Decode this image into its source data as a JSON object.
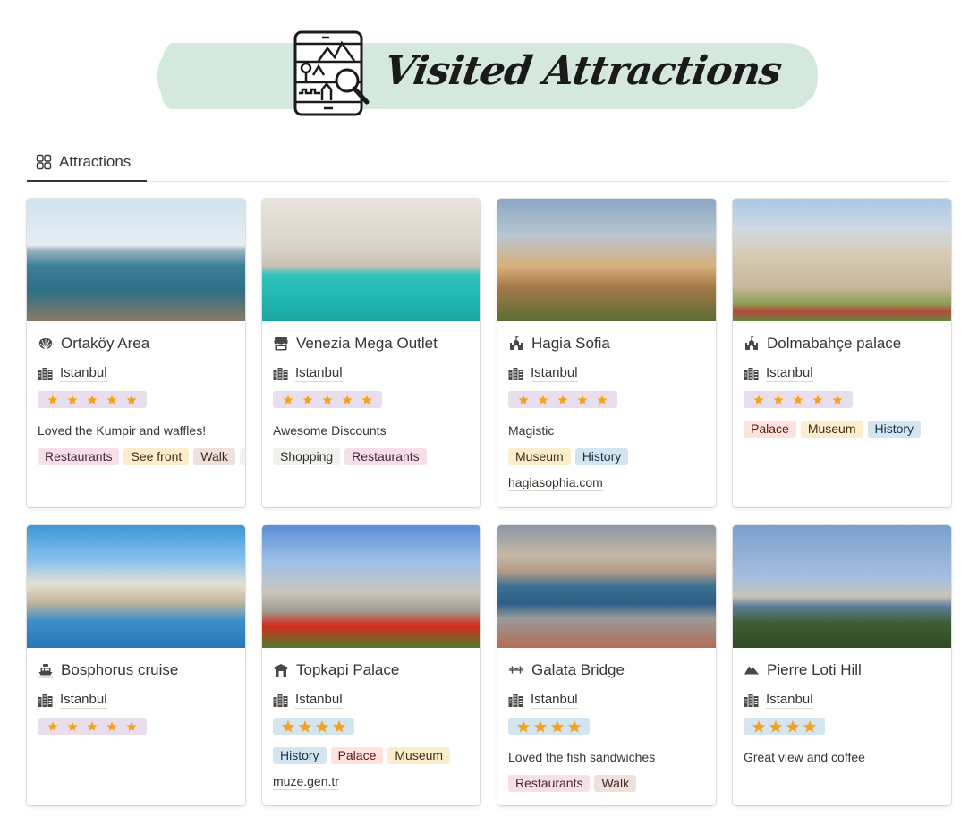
{
  "banner": {
    "title": "Visited Attractions",
    "logo_icon": "phone-landscape-search-icon"
  },
  "view_tabs": [
    {
      "label": "Attractions",
      "icon": "gallery-grid-icon",
      "active": true
    }
  ],
  "tag_colors": {
    "Restaurants": {
      "bg": "#f5e0e9",
      "fg": "#4c2337"
    },
    "See front": {
      "bg": "#fbeecc",
      "fg": "#402c1b"
    },
    "Walk": {
      "bg": "#eee0da",
      "fg": "#442a1e"
    },
    "Shopping": {
      "bg": "#f1f1ef",
      "fg": "#32302c"
    },
    "Museum": {
      "bg": "#fbeecc",
      "fg": "#402c1b"
    },
    "History": {
      "bg": "#d3e5ef",
      "fg": "#183347"
    },
    "Palace": {
      "bg": "#ffe2dd",
      "fg": "#5d1715"
    }
  },
  "cards": [
    {
      "title": "Ortaköy Area",
      "icon": "seashell-icon",
      "city": "Istanbul",
      "rating": 5,
      "rating_color": "purple",
      "note": "Loved the Kumpir and waffles!",
      "tags": [
        "Restaurants",
        "See front",
        "Walk",
        ""
      ],
      "link": ""
    },
    {
      "title": "Venezia Mega Outlet",
      "icon": "storefront-icon",
      "city": "Istanbul",
      "rating": 5,
      "rating_color": "purple",
      "note": "Awesome Discounts",
      "tags": [
        "Shopping",
        "Restaurants"
      ],
      "link": ""
    },
    {
      "title": "Hagia Sofia",
      "icon": "castle-icon",
      "city": "Istanbul",
      "rating": 5,
      "rating_color": "purple",
      "note": "Magistic",
      "tags": [
        "Museum",
        "History"
      ],
      "link": "hagiasophia.com"
    },
    {
      "title": "Dolmabahçe palace",
      "icon": "castle-icon",
      "city": "Istanbul",
      "rating": 5,
      "rating_color": "purple",
      "note": "",
      "tags": [
        "Palace",
        "Museum",
        "History"
      ],
      "link": ""
    },
    {
      "title": "Bosphorus cruise",
      "icon": "ship-icon",
      "city": "Istanbul",
      "rating": 5,
      "rating_color": "purple",
      "note": "",
      "tags": [],
      "link": ""
    },
    {
      "title": "Topkapi Palace",
      "icon": "temple-gate-icon",
      "city": "Istanbul",
      "rating": 4,
      "rating_color": "blue",
      "note": "",
      "tags": [
        "History",
        "Palace",
        "Museum"
      ],
      "link": "muze.gen.tr"
    },
    {
      "title": "Galata Bridge",
      "icon": "bridge-icon",
      "city": "Istanbul",
      "rating": 4,
      "rating_color": "blue",
      "note": "Loved the fish sandwiches",
      "tags": [
        "Restaurants",
        "Walk"
      ],
      "link": ""
    },
    {
      "title": "Pierre Loti Hill",
      "icon": "mountain-icon",
      "city": "Istanbul",
      "rating": 4,
      "rating_color": "blue",
      "note": "Great view and coffee",
      "tags": [],
      "link": ""
    }
  ]
}
